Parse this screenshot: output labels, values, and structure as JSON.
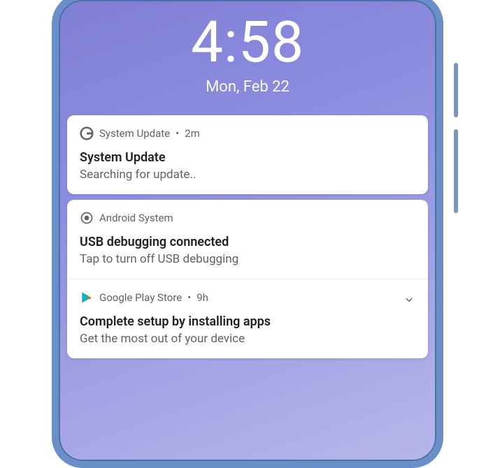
{
  "lockscreen": {
    "time": "4:58",
    "date": "Mon, Feb 22"
  },
  "notifications": [
    {
      "app_name": "System Update",
      "time": "2m",
      "icon": "google-g-icon",
      "title": "System Update",
      "body": "Searching for update.."
    },
    {
      "items": [
        {
          "app_name": "Android System",
          "time": "",
          "icon": "android-system-icon",
          "title": "USB debugging connected",
          "body": "Tap to turn off USB debugging",
          "expandable": false
        },
        {
          "app_name": "Google Play Store",
          "time": "9h",
          "icon": "play-store-icon",
          "title": "Complete setup by installing apps",
          "body": "Get the most out of your device",
          "expandable": true
        }
      ]
    }
  ]
}
